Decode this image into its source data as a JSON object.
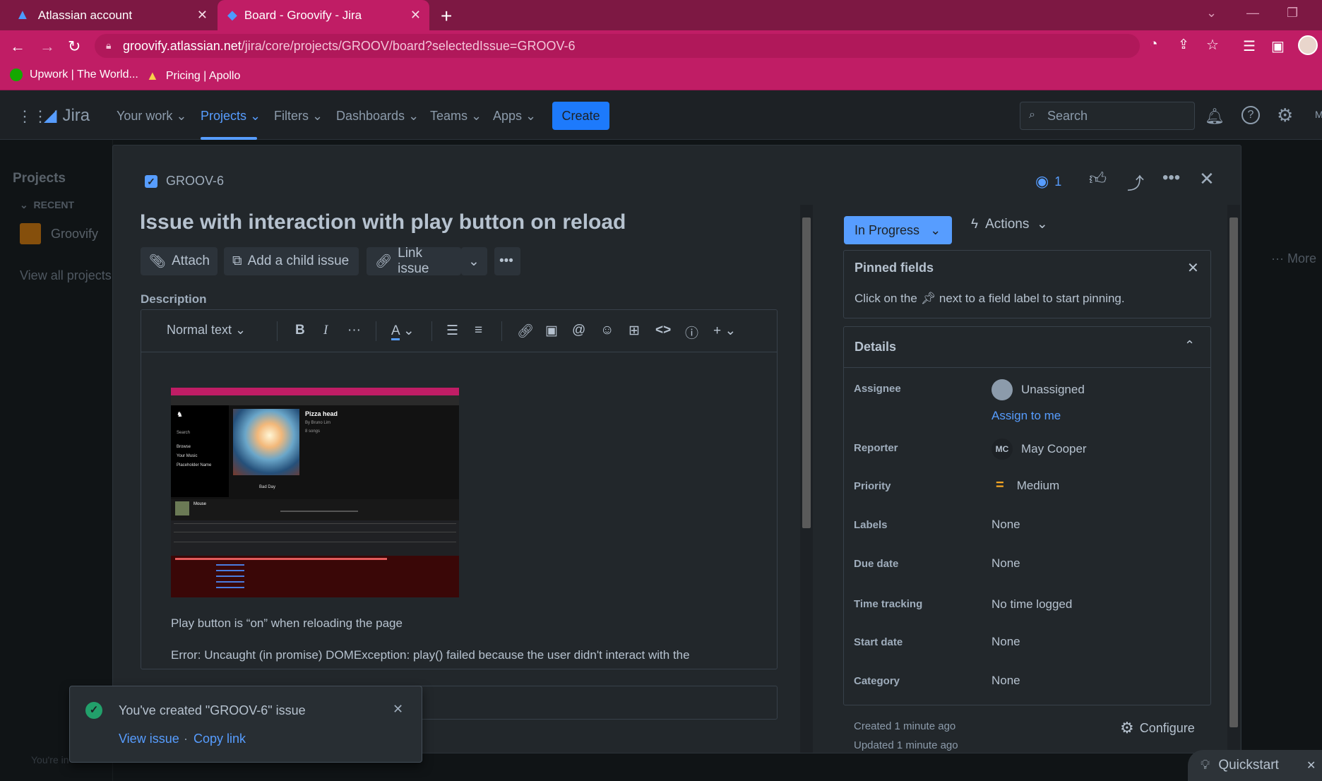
{
  "browser": {
    "tabs": [
      {
        "label": "Atlassian account",
        "active": false
      },
      {
        "label": "Board - Groovify - Jira",
        "active": true
      }
    ],
    "url_host": "groovify.atlassian.net",
    "url_path": "/jira/core/projects/GROOV/board?selectedIssue=GROOV-6",
    "bookmarks": [
      {
        "label": "Upwork | The World...",
        "icon": "upwork-icon"
      },
      {
        "label": "Pricing | Apollo",
        "icon": "apollo-icon"
      }
    ],
    "accent": "#c01d65"
  },
  "jira": {
    "logo": "Jira",
    "nav": [
      "Your work",
      "Projects",
      "Filters",
      "Dashboards",
      "Teams",
      "Apps"
    ],
    "create": "Create",
    "search_placeholder": "Search",
    "avatar_initial": "M"
  },
  "sidebar": {
    "title": "Projects",
    "recent": "RECENT",
    "project": "Groovify",
    "view_all": "View all projects"
  },
  "background": {
    "more": "More",
    "footer": "You're in"
  },
  "issue": {
    "key": "GROOV-6",
    "watchers": "1",
    "title": "Issue with interaction with play button on reload",
    "buttons": {
      "attach": "Attach",
      "child": "Add a child issue",
      "link": "Link issue"
    },
    "description_label": "Description",
    "editor": {
      "text_style": "Normal text"
    },
    "screenshot": {
      "song": "Pizza head",
      "artist": "By Bruno Lim",
      "songs": "8 songs",
      "sidebar_items": [
        "Browse",
        "Your Music",
        "Placeholder Name"
      ],
      "search": "Search",
      "track": "Bad Day",
      "player_title": "Mouse"
    },
    "desc_line1": "Play button is “on” when reloading the page",
    "desc_line2": "Error: Uncaught (in promise) DOMException: play() failed because the user didn't interact with the",
    "status": "In Progress",
    "actions": "Actions",
    "pinned": {
      "title": "Pinned fields",
      "hint_pre": "Click on the",
      "hint_post": "next to a field label to start pinning."
    },
    "details": {
      "title": "Details",
      "fields": [
        {
          "label": "Assignee",
          "value": "Unassigned"
        },
        {
          "label": "Reporter",
          "value": "May Cooper"
        },
        {
          "label": "Priority",
          "value": "Medium"
        },
        {
          "label": "Labels",
          "value": "None"
        },
        {
          "label": "Due date",
          "value": "None"
        },
        {
          "label": "Time tracking",
          "value": "No time logged"
        },
        {
          "label": "Start date",
          "value": "None"
        },
        {
          "label": "Category",
          "value": "None"
        }
      ],
      "assign_to_me": "Assign to me",
      "reporter_initials": "MC"
    },
    "created": "Created 1 minute ago",
    "updated": "Updated 1 minute ago",
    "configure": "Configure"
  },
  "toast": {
    "message": "You've created \"GROOV-6\" issue",
    "view": "View issue",
    "dot": "·",
    "copy": "Copy link"
  },
  "quickstart": "Quickstart"
}
